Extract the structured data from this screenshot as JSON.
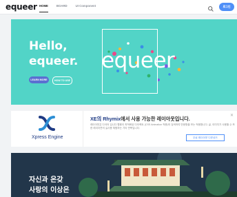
{
  "header": {
    "logo": "equeer",
    "nav": [
      "HOME",
      "BOARD",
      "UI Component"
    ],
    "login_label": "로그인"
  },
  "hero": {
    "title_line1": "Hello,",
    "title_line2": "equeer.",
    "learn_more": "LEARN MORE",
    "how_to_use": "HOW TO USE",
    "brand_text": "equeer",
    "background": "#52d4c7"
  },
  "ad": {
    "logo_text": "Xpress Engine",
    "title_prefix": "XE의 Rhymix",
    "title_suffix": "에서 사용 가능한 레이아웃입니다.",
    "description": "레이아웃은 다국어 입니다 활용이 최적화된 다이렉트 (CSS Animation 적용)의 검색하여 반응형을 보는 적용합니다. 글, 이미지가 사용할 수 또한 레이아웃의 실사용 체험하는 기타 반복입니다.",
    "button_label": "무료 레이아웃 다운로드"
  },
  "banner": {
    "line1": "자신과 온갖",
    "line2": "사랑의 이상은"
  },
  "colors": {
    "accent": "#4f8ff7",
    "hero_bg": "#52d4c7",
    "xe_blue": "#1f3b84"
  }
}
